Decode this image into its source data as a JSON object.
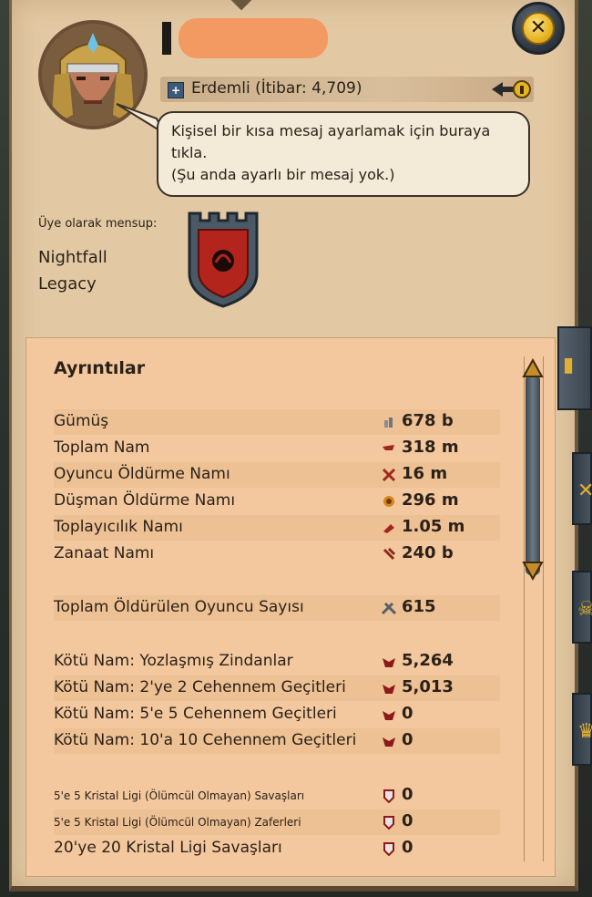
{
  "header": {
    "close_label": "✕"
  },
  "profile": {
    "title_text": "Erdemli (İtibar: 4,709)",
    "bubble_text": "Kişisel bir kısa mesaj ayarlamak için buraya tıkla.\n(Şu anda ayarlı bir mesaj yok.)",
    "guild_label": "Üye olarak mensup:",
    "guild_name": "Nightfall Legacy"
  },
  "details": {
    "title": "Ayrıntılar",
    "rows": [
      {
        "label": "Gümüş",
        "icon": "silver-icon",
        "value": "678 b"
      },
      {
        "label": "Toplam Nam",
        "icon": "fame-icon",
        "value": "318 m"
      },
      {
        "label": "Oyuncu Öldürme Namı",
        "icon": "pvp-fame-icon",
        "value": "16 m"
      },
      {
        "label": "Düşman Öldürme Namı",
        "icon": "pve-fame-icon",
        "value": "296 m"
      },
      {
        "label": "Toplayıcılık Namı",
        "icon": "gathering-fame-icon",
        "value": "1.05 m"
      },
      {
        "label": "Zanaat Namı",
        "icon": "crafting-fame-icon",
        "value": "240 b"
      },
      {
        "label": "Toplam Öldürülen Oyuncu Sayısı",
        "icon": "kills-icon",
        "value": "615"
      },
      {
        "label": "Kötü Nam: Yozlaşmış Zindanlar",
        "icon": "infamy-icon",
        "value": "5,264"
      },
      {
        "label": "Kötü Nam: 2'ye 2 Cehennem Geçitleri",
        "icon": "infamy-icon",
        "value": "5,013"
      },
      {
        "label": "Kötü Nam: 5'e 5 Cehennem Geçitleri",
        "icon": "infamy-icon",
        "value": "0"
      },
      {
        "label": "Kötü Nam: 10'a 10 Cehennem Geçitleri",
        "icon": "infamy-icon",
        "value": "0"
      },
      {
        "label": "5'e 5 Kristal Ligi (Ölümcül Olmayan) Savaşları",
        "icon": "crystal-icon",
        "value": "0"
      },
      {
        "label": "5'e 5 Kristal Ligi (Ölümcül Olmayan) Zaferleri",
        "icon": "crystal-icon",
        "value": "0"
      },
      {
        "label": "20'ye 20 Kristal Ligi Savaşları",
        "icon": "crystal-icon",
        "value": "0"
      }
    ]
  },
  "colors": {
    "panel": "#e3c9a3",
    "details_bg": "#f3c89e",
    "close_accent": "#e0a813",
    "infamy": "#8b1a1a",
    "fame": "#a0261e"
  }
}
